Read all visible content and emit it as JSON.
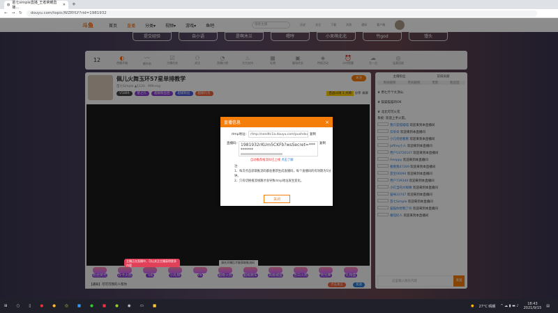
{
  "browser": {
    "tab_title": "苗七simple直播_王者荣耀直播...",
    "url": "douyu.com/topic/WZRYLY?rid=1981932"
  },
  "nav": {
    "items": [
      "首页",
      "直播",
      "分类▾",
      "视频▾",
      "游戏▾",
      "鱼吧"
    ],
    "search_placeholder": "搜索主播",
    "user_icons": [
      "历史",
      "关注",
      "下载",
      "消息",
      "通知",
      "客户端"
    ]
  },
  "streamers": [
    "提交经验",
    "自小语",
    "是啊木兰",
    "嗯哼",
    "小呆萌北北",
    "竹god",
    "馒头"
  ],
  "toolbar": {
    "count": "12",
    "items": [
      "首播开箱",
      "额外助",
      "主播任务",
      "关注",
      "直播口袋",
      "大力支持",
      "礼物",
      "暖场任务",
      "特权活动",
      "计时提醒",
      "左一点",
      "连麦回放"
    ],
    "badge": "1"
  },
  "room": {
    "title": "佩儿火舞玉环57星单排教学",
    "streamer": "苗七Simple",
    "heat": "1120",
    "followers": "999+kg",
    "follow_label": "关注",
    "report": "举报",
    "share": "分享",
    "record": "录屏",
    "tags": [
      "V5889",
      "星之礼",
      "超级粉丝团",
      "超级粉丝",
      "超级礼包"
    ],
    "rank": "百战斗场 1 大师"
  },
  "gifts": {
    "tip": "主播正在直播中，可以关注主播获得更多内容",
    "items": [
      "粉丝荧光",
      "办卡火箭",
      "飞机",
      "小礼物",
      "PK",
      "超级火箭",
      "超级跑车",
      "高级城堡",
      "告白火箭",
      "荧光棒",
      "礼物盒"
    ],
    "chat_hint": "【通知】可可可我的人帮你",
    "send": "发送",
    "input_hint": "点击发言",
    "bubble": "请先开播后才能获取推流码"
  },
  "chat": {
    "tabs": [
      "主播粉丝",
      "前排贡献"
    ],
    "ranks": [
      "周贡献榜",
      "月贡献榜",
      "贵宾",
      "粉丝团"
    ],
    "vip": [
      "用七斤个大顶山",
      "猫猫猫猫的OK",
      "北北可可火花"
    ],
    "notice": "系统: 欢迎上手火箭。",
    "messages": [
      {
        "user": "我只是喵喵喵",
        "text": "欢迎来到本直播间"
      },
      {
        "user": "云朵朵",
        "text": "欢迎来到本直播间"
      },
      {
        "user": "小几何想看看",
        "text": "欢迎来到本直播间"
      },
      {
        "user": "Joffrey小人",
        "text": "欢迎来到本直播间"
      },
      {
        "user": "用户53726147",
        "text": "欢迎来到本直播间"
      },
      {
        "user": "Heeppy",
        "text": "欢迎来到本直播间"
      },
      {
        "user": "看看我47269",
        "text": "欢迎来到本直播间"
      },
      {
        "user": "苗宝06090",
        "text": "欢迎来到本直播间"
      },
      {
        "user": "用户739344",
        "text": "欢迎来到本直播间"
      },
      {
        "user": "小叮当的大眼睛",
        "text": "欢迎来到本直播间"
      },
      {
        "user": "猫咪33747",
        "text": "欢迎来到本直播间"
      },
      {
        "user": "苗七Simple",
        "text": "欢迎来到本直播间"
      },
      {
        "user": "猫猫你想我了吗",
        "text": "欢迎来到本直播间"
      },
      {
        "user": "番茄好人",
        "text": "欢迎来到本直播间"
      }
    ],
    "input_placeholder": "这里输入聊天内容",
    "send": "发送"
  },
  "modal": {
    "title": "直播信息",
    "rtmp_label": "rtmp地址:",
    "rtmp_value": "rtmp://sendtc1a.douyu.com/pushdouyu",
    "key_label": "直播码:",
    "key_value": "1981932rKUm5CKFb?wsSecret=*********",
    "copy": "复制",
    "warn": "自动推荐推流码已上线",
    "learn": "点击了解",
    "notes": [
      "注:",
      "1、每次点击获取推流码都会重新生成直播码，每个直播码的有效期为5分钟。",
      "2、只有切换推流线路才会导致rtmp地址发生变化。"
    ],
    "close_button": "关闭"
  },
  "taskbar": {
    "weather": "27°C 晴朗",
    "time": "18:43",
    "date": "2021/9/15"
  }
}
